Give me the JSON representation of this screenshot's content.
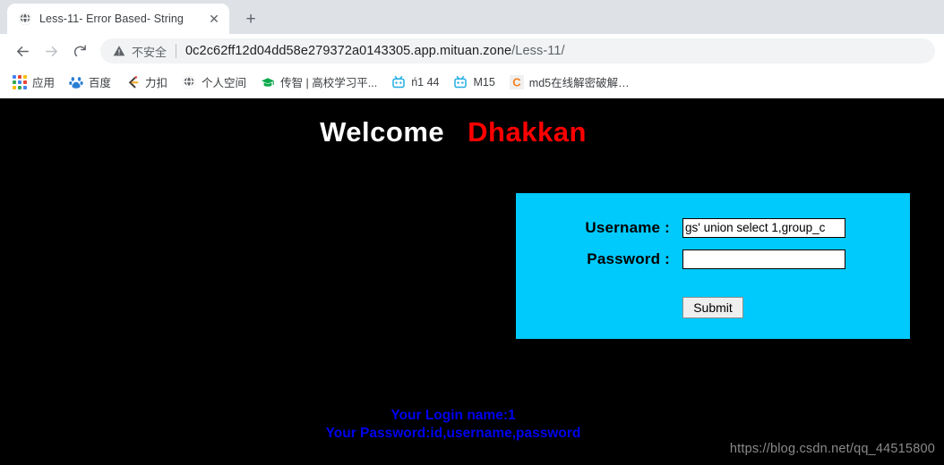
{
  "browser": {
    "tab": {
      "title": "Less-11- Error Based- String",
      "favicon_name": "globe-icon",
      "close_glyph": "✕",
      "newtab_glyph": "+"
    },
    "nav": {
      "back_glyph": "←",
      "forward_glyph": "→",
      "reload_glyph": "⟳"
    },
    "omnibox": {
      "security_label": "不安全",
      "url_host": "0c2c62ff12d04dd58e279372a0143305.app.mituan.zone",
      "url_path": "/Less-11/"
    },
    "bookmarks": [
      {
        "label": "应用",
        "icon": "apps-grid-icon"
      },
      {
        "label": "百度",
        "icon": "baidu-icon"
      },
      {
        "label": "力扣",
        "icon": "leetcode-icon"
      },
      {
        "label": "个人空间",
        "icon": "globe-icon"
      },
      {
        "label": "传智 | 高校学习平...",
        "icon": "graduation-cap-icon"
      },
      {
        "label": "ń1 44",
        "icon": "robot-icon"
      },
      {
        "label": "M15",
        "icon": "robot-icon"
      },
      {
        "label": "md5在线解密破解,...",
        "icon": "letter-c-icon"
      }
    ]
  },
  "page": {
    "heading": {
      "welcome": "Welcome",
      "name": "Dhakkan"
    },
    "form": {
      "username_label": "Username :",
      "username_value": "gs' union select 1,group_c",
      "password_label": "Password :",
      "password_value": "",
      "submit_label": "Submit"
    },
    "result": {
      "line1": "Your Login name:1",
      "line2": "Your Password:id,username,password"
    },
    "watermark": "https://blog.csdn.net/qq_44515800",
    "colors": {
      "page_background": "#000000",
      "form_background": "#00c9fb",
      "welcome_color": "#ffffff",
      "name_color": "#ff0000",
      "result_color": "#0000ee"
    }
  }
}
